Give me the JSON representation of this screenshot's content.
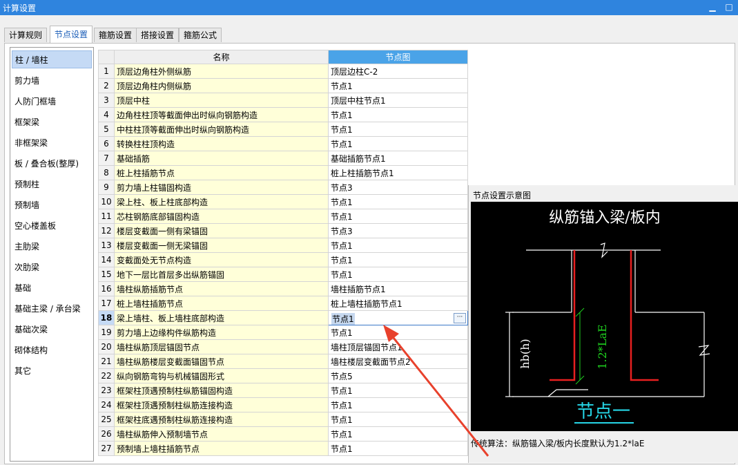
{
  "window": {
    "title": "计算设置",
    "minimize": "▁",
    "maximize": "□"
  },
  "tabs": [
    {
      "label": "计算规则",
      "active": false
    },
    {
      "label": "节点设置",
      "active": true
    },
    {
      "label": "箍筋设置",
      "active": false
    },
    {
      "label": "搭接设置",
      "active": false
    },
    {
      "label": "箍筋公式",
      "active": false
    }
  ],
  "sidebar": {
    "items": [
      {
        "label": "柱 / 墙柱",
        "active": true
      },
      {
        "label": "剪力墙"
      },
      {
        "label": "人防门框墙"
      },
      {
        "label": "框架梁"
      },
      {
        "label": "非框架梁"
      },
      {
        "label": "板 / 叠合板(整厚)"
      },
      {
        "label": "预制柱"
      },
      {
        "label": "预制墙"
      },
      {
        "label": "空心楼盖板"
      },
      {
        "label": "主肋梁"
      },
      {
        "label": "次肋梁"
      },
      {
        "label": "基础"
      },
      {
        "label": "基础主梁 / 承台梁"
      },
      {
        "label": "基础次梁"
      },
      {
        "label": "砌体结构"
      },
      {
        "label": "其它"
      }
    ]
  },
  "table": {
    "headers": {
      "name": "名称",
      "node": "节点图"
    },
    "selected_row": 18,
    "rows": [
      {
        "idx": "1",
        "name": "顶层边角柱外侧纵筋",
        "value": "顶层边柱C-2"
      },
      {
        "idx": "2",
        "name": "顶层边角柱内侧纵筋",
        "value": "节点1"
      },
      {
        "idx": "3",
        "name": "顶层中柱",
        "value": "顶层中柱节点1"
      },
      {
        "idx": "4",
        "name": "边角柱柱顶等截面伸出时纵向钢筋构造",
        "value": "节点1"
      },
      {
        "idx": "5",
        "name": "中柱柱顶等截面伸出时纵向钢筋构造",
        "value": "节点1"
      },
      {
        "idx": "6",
        "name": "转换柱柱顶构造",
        "value": "节点1"
      },
      {
        "idx": "7",
        "name": "基础插筋",
        "value": "基础插筋节点1"
      },
      {
        "idx": "8",
        "name": "桩上柱插筋节点",
        "value": "桩上柱插筋节点1"
      },
      {
        "idx": "9",
        "name": "剪力墙上柱锚固构造",
        "value": "节点3"
      },
      {
        "idx": "10",
        "name": "梁上柱、板上柱底部构造",
        "value": "节点1"
      },
      {
        "idx": "11",
        "name": "芯柱钢筋底部锚固构造",
        "value": "节点1"
      },
      {
        "idx": "12",
        "name": "楼层变截面一侧有梁锚固",
        "value": "节点3"
      },
      {
        "idx": "13",
        "name": "楼层变截面一侧无梁锚固",
        "value": "节点1"
      },
      {
        "idx": "14",
        "name": "变截面处无节点构造",
        "value": "节点1"
      },
      {
        "idx": "15",
        "name": "地下一层比首层多出纵筋锚固",
        "value": "节点1"
      },
      {
        "idx": "16",
        "name": "墙柱纵筋插筋节点",
        "value": "墙柱插筋节点1"
      },
      {
        "idx": "17",
        "name": "桩上墙柱插筋节点",
        "value": "桩上墙柱插筋节点1"
      },
      {
        "idx": "18",
        "name": "梁上墙柱、板上墙柱底部构造",
        "value": "节点1"
      },
      {
        "idx": "19",
        "name": "剪力墙上边缘构件纵筋构造",
        "value": "节点1"
      },
      {
        "idx": "20",
        "name": "墙柱纵筋顶层锚固节点",
        "value": "墙柱顶层锚固节点1"
      },
      {
        "idx": "21",
        "name": "墙柱纵筋楼层变截面锚固节点",
        "value": "墙柱楼层变截面节点2"
      },
      {
        "idx": "22",
        "name": "纵向钢筋弯钩与机械锚固形式",
        "value": "节点5"
      },
      {
        "idx": "23",
        "name": "框架柱顶遇预制柱纵筋锚固构造",
        "value": "节点1"
      },
      {
        "idx": "24",
        "name": "框架柱顶遇预制柱纵筋连接构造",
        "value": "节点1"
      },
      {
        "idx": "25",
        "name": "框架柱底遇预制柱纵筋连接构造",
        "value": "节点1"
      },
      {
        "idx": "26",
        "name": "墙柱纵筋伸入预制墙节点",
        "value": "节点1"
      },
      {
        "idx": "27",
        "name": "预制墙上墙柱插筋节点",
        "value": "节点1"
      }
    ]
  },
  "preview": {
    "title": "节点设置示意图",
    "diagram_title": "纵筋锚入梁/板内",
    "dim_label_left": "hb(h)",
    "dim_label_right": "1.2*LaE",
    "node_label": "节点一",
    "note": "传统算法：纵筋锚入梁/板内长度默认为1.2*laE",
    "colors": {
      "background": "#000000",
      "white_lines": "#ffffff",
      "rebar": "#e82020",
      "dim_green": "#1fd11f",
      "node_label": "#26d7e8"
    }
  },
  "annotation": {
    "arrow_color": "#e8412c"
  }
}
